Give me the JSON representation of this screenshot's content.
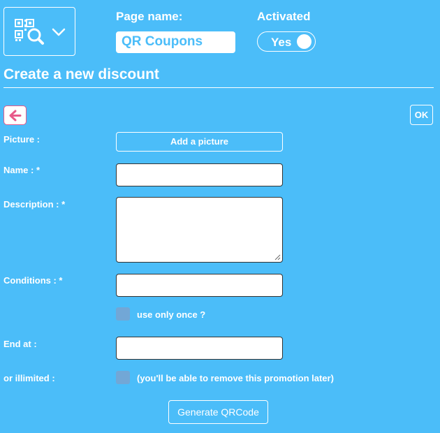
{
  "header": {
    "page_name_label": "Page name:",
    "page_name_value": "QR Coupons",
    "activated_label": "Activated",
    "activated_value": "Yes",
    "menu_icon": "qr-search-icon",
    "dropdown_icon": "chevron-down-icon"
  },
  "title": "Create a new discount",
  "toolbar": {
    "back_icon": "arrow-left-icon",
    "ok_label": "OK"
  },
  "form": {
    "picture_label": "Picture :",
    "add_picture_label": "Add a picture",
    "name_label": "Name : *",
    "name_value": "",
    "description_label": "Description : *",
    "description_value": "",
    "conditions_label": "Conditions : *",
    "conditions_value": "",
    "use_once_label": "use only once ?",
    "use_once_checked": false,
    "end_at_label": "End at :",
    "end_at_value": "",
    "unlimited_label": "or illimited :",
    "unlimited_note": "(you'll be able to remove this promotion later)",
    "unlimited_checked": false,
    "generate_label": "Generate QRCode"
  },
  "colors": {
    "background": "#4bbdf9",
    "back_arrow": "#e85a8a",
    "checkbox": "#72a7d6"
  }
}
